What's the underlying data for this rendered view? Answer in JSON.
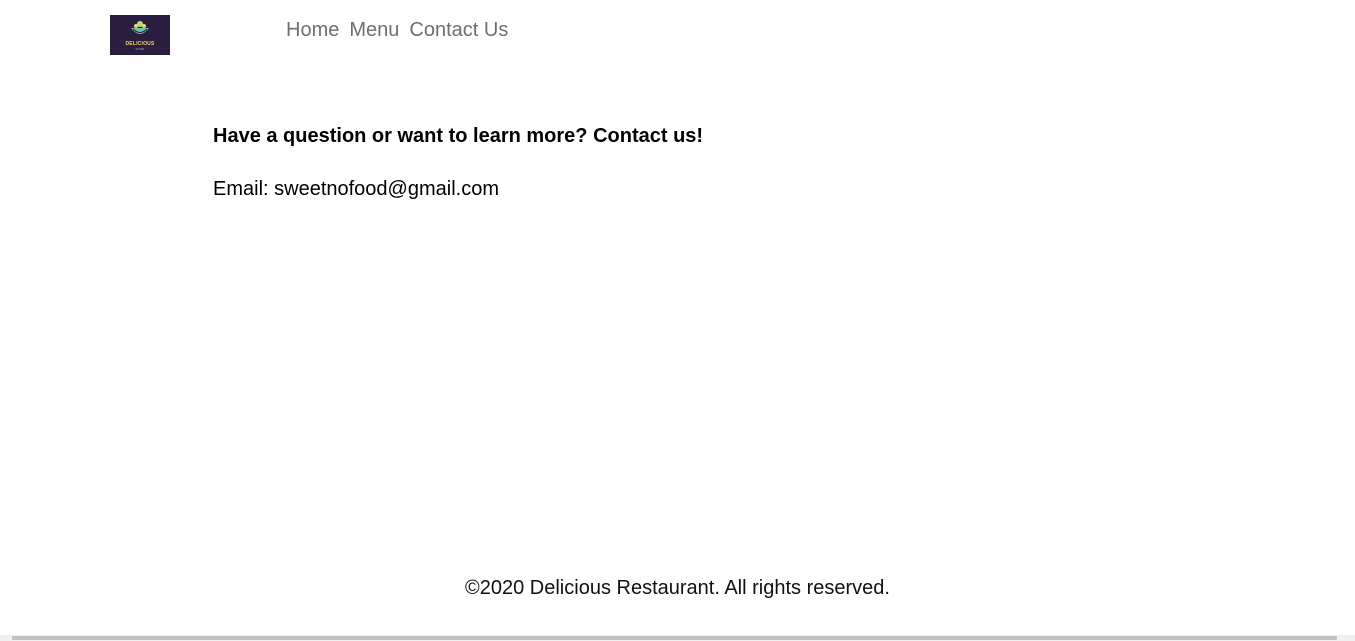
{
  "logo": {
    "text": "DELICIOUS",
    "subtext": "FOOD"
  },
  "nav": {
    "items": [
      {
        "label": "Home"
      },
      {
        "label": "Menu"
      },
      {
        "label": "Contact Us"
      }
    ]
  },
  "main": {
    "heading": "Have a question or want to learn more? Contact us!",
    "email_text": "Email: sweetnofood@gmail.com"
  },
  "footer": {
    "copyright": "©2020 Delicious Restaurant. All rights reserved."
  },
  "colors": {
    "logo_background": "#2a1d3f",
    "nav_link": "#6f6f6f",
    "text": "#000000"
  }
}
